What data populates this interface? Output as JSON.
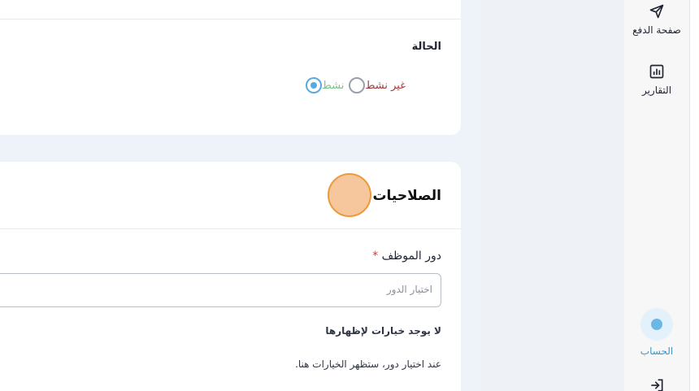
{
  "status": {
    "title": "الحالة",
    "options": [
      {
        "label": "نشط",
        "selected": true
      },
      {
        "label": "غير نشط",
        "selected": false
      }
    ]
  },
  "permissions": {
    "title": "الصلاحيات",
    "role_label": "دور الموظف",
    "required_mark": "*",
    "role_placeholder": "اختيار الدور",
    "empty_title": "لا يوجد خيارات لإظهارها",
    "empty_desc": "عند اختيار دور، ستظهر الخيارات هنا."
  },
  "sidebar": {
    "items": [
      {
        "label": "صفحة الدفع",
        "icon": "send-icon"
      },
      {
        "label": "التقارير",
        "icon": "bar-chart-icon"
      },
      {
        "label": "الحساب",
        "icon": "user-icon",
        "active": true
      },
      {
        "label": "",
        "icon": "logout-icon"
      }
    ]
  },
  "colors": {
    "accent": "#5aa9e0",
    "active_status": "#7bc38a",
    "inactive_status": "#a53a3a",
    "highlight_dot": "#f6c79d"
  }
}
